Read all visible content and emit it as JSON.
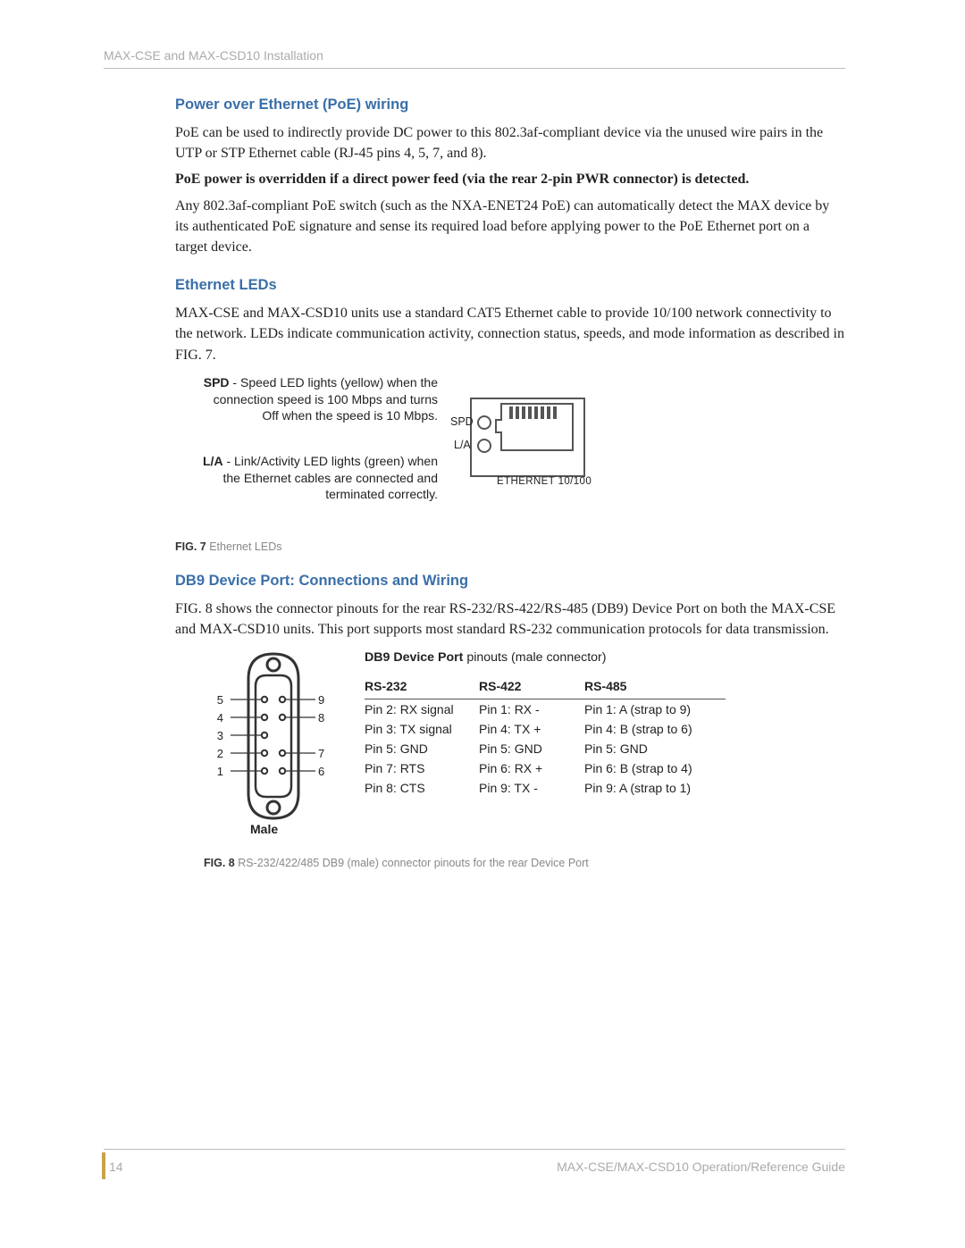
{
  "header": {
    "breadcrumb": "MAX-CSE and MAX-CSD10 Installation"
  },
  "sections": {
    "poe": {
      "heading": "Power over Ethernet (PoE) wiring",
      "p1": "PoE can be used to indirectly provide DC power to this 802.3af-compliant device via the unused wire pairs in the UTP or STP Ethernet cable (RJ-45 pins 4, 5, 7, and 8).",
      "bold": "PoE power is overridden if a direct power feed (via the rear 2-pin PWR connector) is detected.",
      "p2": "Any 802.3af-compliant PoE switch (such as the NXA-ENET24 PoE) can automatically detect the MAX device by its authenticated PoE signature and sense its required load before applying power to the PoE Ethernet port on a target device."
    },
    "leds": {
      "heading": "Ethernet LEDs",
      "p1": "MAX-CSE and MAX-CSD10 units use a standard CAT5 Ethernet cable to provide 10/100 network connectivity to the network. LEDs indicate communication activity, connection status, speeds, and mode information as described in FIG. 7."
    },
    "db9": {
      "heading": "DB9 Device Port: Connections and Wiring",
      "p1": "FIG. 8 shows the connector pinouts for the rear RS-232/RS-422/RS-485 (DB9) Device Port on both the MAX-CSE and MAX-CSD10 units. This port supports most standard RS-232 communication protocols for data transmission."
    }
  },
  "fig7": {
    "spd_bold": "SPD",
    "spd_text": " - Speed LED lights (yellow) when the connection speed is 100 Mbps and turns Off when the speed is 10 Mbps.",
    "la_bold": "L/A",
    "la_text": " - Link/Activity LED lights (green) when the Ethernet cables are connected and terminated correctly.",
    "spd_label": "SPD",
    "la_label": "L/A",
    "port_caption": "ETHERNET 10/100",
    "caption_strong": "FIG. 7",
    "caption": "  Ethernet LEDs"
  },
  "fig8": {
    "male_label": "Male",
    "pin_left": [
      "5",
      "4",
      "3",
      "2",
      "1"
    ],
    "pin_right": [
      "9",
      "8",
      "7",
      "6"
    ],
    "table_title_bold": "DB9 Device Port",
    "table_title_rest": " pinouts (male connector)",
    "headers": [
      "RS-232",
      "RS-422",
      "RS-485"
    ],
    "rows": [
      [
        "Pin 2: RX signal",
        "Pin 1: RX -",
        "Pin 1: A (strap to 9)"
      ],
      [
        "Pin 3: TX signal",
        "Pin 4: TX +",
        "Pin 4: B (strap to 6)"
      ],
      [
        "Pin 5: GND",
        "Pin 5: GND",
        "Pin 5: GND"
      ],
      [
        "Pin 7: RTS",
        "Pin 6: RX +",
        "Pin 6: B (strap to 4)"
      ],
      [
        "Pin 8: CTS",
        "Pin 9: TX -",
        "Pin 9: A (strap to 1)"
      ]
    ],
    "caption_strong": "FIG. 8",
    "caption": "  RS-232/422/485 DB9 (male) connector pinouts for the rear Device Port"
  },
  "footer": {
    "page": "14",
    "title": "MAX-CSE/MAX-CSD10 Operation/Reference Guide"
  }
}
